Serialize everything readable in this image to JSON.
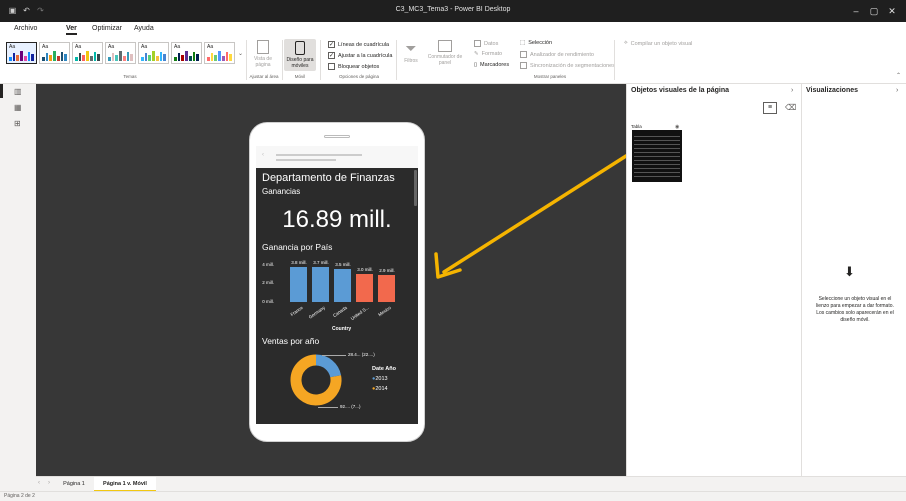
{
  "window": {
    "title": "C3_MC3_Tema3 - Power BI Desktop",
    "minimize": "–",
    "maximize": "▢",
    "close": "✕"
  },
  "menu": [
    "Archivo",
    "Ver",
    "Optimizar",
    "Ayuda"
  ],
  "menu_active": "Ver",
  "ribbon": {
    "themes_label": "Temas",
    "theme_sample": "Aa",
    "theme_palettes": [
      [
        "#118dff",
        "#12239e",
        "#e66c37",
        "#6b007b",
        "#e044a7"
      ],
      [
        "#1b4f72",
        "#2e86c1",
        "#f39c12",
        "#27ae60",
        "#c0392b"
      ],
      [
        "#01b8aa",
        "#374649",
        "#fd625e",
        "#f2c80f",
        "#5f6b6d"
      ],
      [
        "#3599b8",
        "#dfbfbf",
        "#4ac5bb",
        "#5f6b6d",
        "#fb8281"
      ],
      [
        "#31b6fd",
        "#4584d3",
        "#5bd078",
        "#a5d028",
        "#f5c040"
      ],
      [
        "#107c10",
        "#002050",
        "#a80000",
        "#5c2d91",
        "#004b50"
      ],
      [
        "#ff6b6b",
        "#ffd93d",
        "#6bcb77",
        "#4d96ff",
        "#9b59b6"
      ]
    ],
    "vista_pagina": "Vista de página",
    "ajustar_label": "Ajustar al área",
    "diseno_moviles": "Diseño para móviles",
    "movil_label": "Móvil",
    "lineas_cuadricula": "Líneas de cuadrícula",
    "ajustar_cuadricula": "Ajustar a la cuadrícula",
    "bloquear_objetos": "Bloquear objetos",
    "opciones_label": "Opciones de página",
    "filtros": "Filtros",
    "conmutador": "Conmutador de panel",
    "datos": "Datos",
    "formato": "Formato",
    "marcadores": "Marcadores",
    "seleccion": "Selección",
    "analizador": "Analizador de rendimiento",
    "sincronizar": "Sincronización de segmentaciones",
    "mostrar_label": "Mostrar paneles",
    "compilar": "Compilar un objeto visual"
  },
  "mobile": {
    "title": "Departamento de Finanzas",
    "ganancias_label": "Ganancias",
    "kpi": "16.89 mill.",
    "bar_title": "Ganancia por País",
    "axis_ticks": [
      "4 mill.",
      "2 mill.",
      "0 mill."
    ],
    "axis_title": "Country",
    "donut_title": "Ventas por año",
    "legend_title": "Date Año",
    "legend": [
      {
        "name": "2013",
        "color": "#5b9bd5"
      },
      {
        "name": "2014",
        "color": "#f5a623"
      }
    ],
    "donut_label_top": "28.4... (22....)",
    "donut_label_bottom": "92.... (7...)"
  },
  "chart_data": [
    {
      "type": "bar",
      "title": "Ganancia por País",
      "xlabel": "Country",
      "ylabel": "",
      "ylim": [
        0,
        4.5
      ],
      "categories": [
        "France",
        "Germany",
        "Canada",
        "United S...",
        "Mexico"
      ],
      "values": [
        3.8,
        3.7,
        3.5,
        3.0,
        2.9
      ],
      "data_labels": [
        "3.8 mill.",
        "3.7 mill.",
        "3.5 mill.",
        "3.0 mill.",
        "2.9 mill."
      ],
      "colors": [
        "#5b9bd5",
        "#5b9bd5",
        "#5b9bd5",
        "#f2694d",
        "#f2694d"
      ]
    },
    {
      "type": "pie",
      "title": "Ventas por año",
      "categories": [
        "2013",
        "2014"
      ],
      "values": [
        22,
        78
      ],
      "colors": [
        "#5b9bd5",
        "#f5a623"
      ]
    }
  ],
  "panels": {
    "objetos_title": "Objetos visuales de la página",
    "tabla_label": "Tabla",
    "visualizaciones_title": "Visualizaciones",
    "hint": "Seleccione un objeto visual en el lienzo para empezar a dar formato. Los cambios solo aparecerán en el diseño móvil."
  },
  "tabs": [
    "Página 1",
    "Página 1 v. Móvil"
  ],
  "active_tab": "Página 1 v. Móvil",
  "status": "Página 2 de 2",
  "colors": {
    "accent_yellow": "#f2c811",
    "arrow": "#f5b400"
  }
}
